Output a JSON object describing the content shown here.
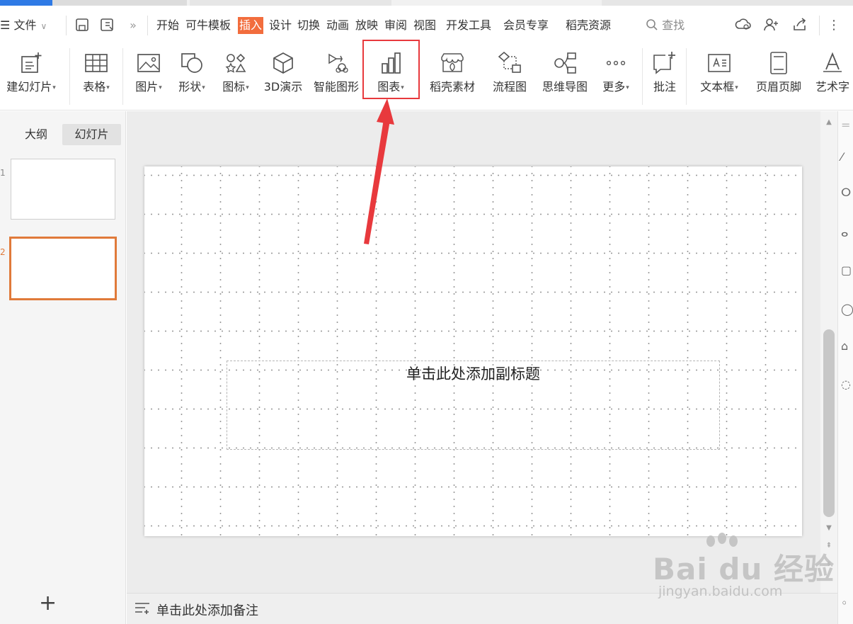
{
  "menubar": {
    "file_label": "文件",
    "tabs": [
      "开始",
      "可牛模板",
      "插入",
      "设计",
      "切换",
      "动画",
      "放映",
      "审阅",
      "视图",
      "开发工具",
      "会员专享",
      "稻壳资源"
    ],
    "active_tab": "插入",
    "search_label": "查找"
  },
  "ribbon": {
    "new_slide": "建幻灯片",
    "table": "表格",
    "picture": "图片",
    "shape": "形状",
    "icon": "图标",
    "model3d": "3D演示",
    "smartart": "智能图形",
    "chart": "图表",
    "daoke": "稻壳素材",
    "flowchart": "流程图",
    "mindmap": "思维导图",
    "more": "更多",
    "comment": "批注",
    "textbox": "文本框",
    "header_footer": "页眉页脚",
    "wordart": "艺术字"
  },
  "left_panel": {
    "tab_outline": "大纲",
    "tab_slides": "幻灯片",
    "slide_numbers": [
      "1",
      "2"
    ],
    "add_slide": "+"
  },
  "slide": {
    "subtitle_placeholder": "单击此处添加副标题"
  },
  "notes": {
    "placeholder": "单击此处添加备注"
  },
  "watermark": {
    "logo_text": "Bai du 经验",
    "url": "jingyan.baidu.com"
  },
  "colors": {
    "active_tab_bg": "#f26d3d",
    "highlight_border": "#e8393d",
    "selected_slide_border": "#e07a3a"
  }
}
